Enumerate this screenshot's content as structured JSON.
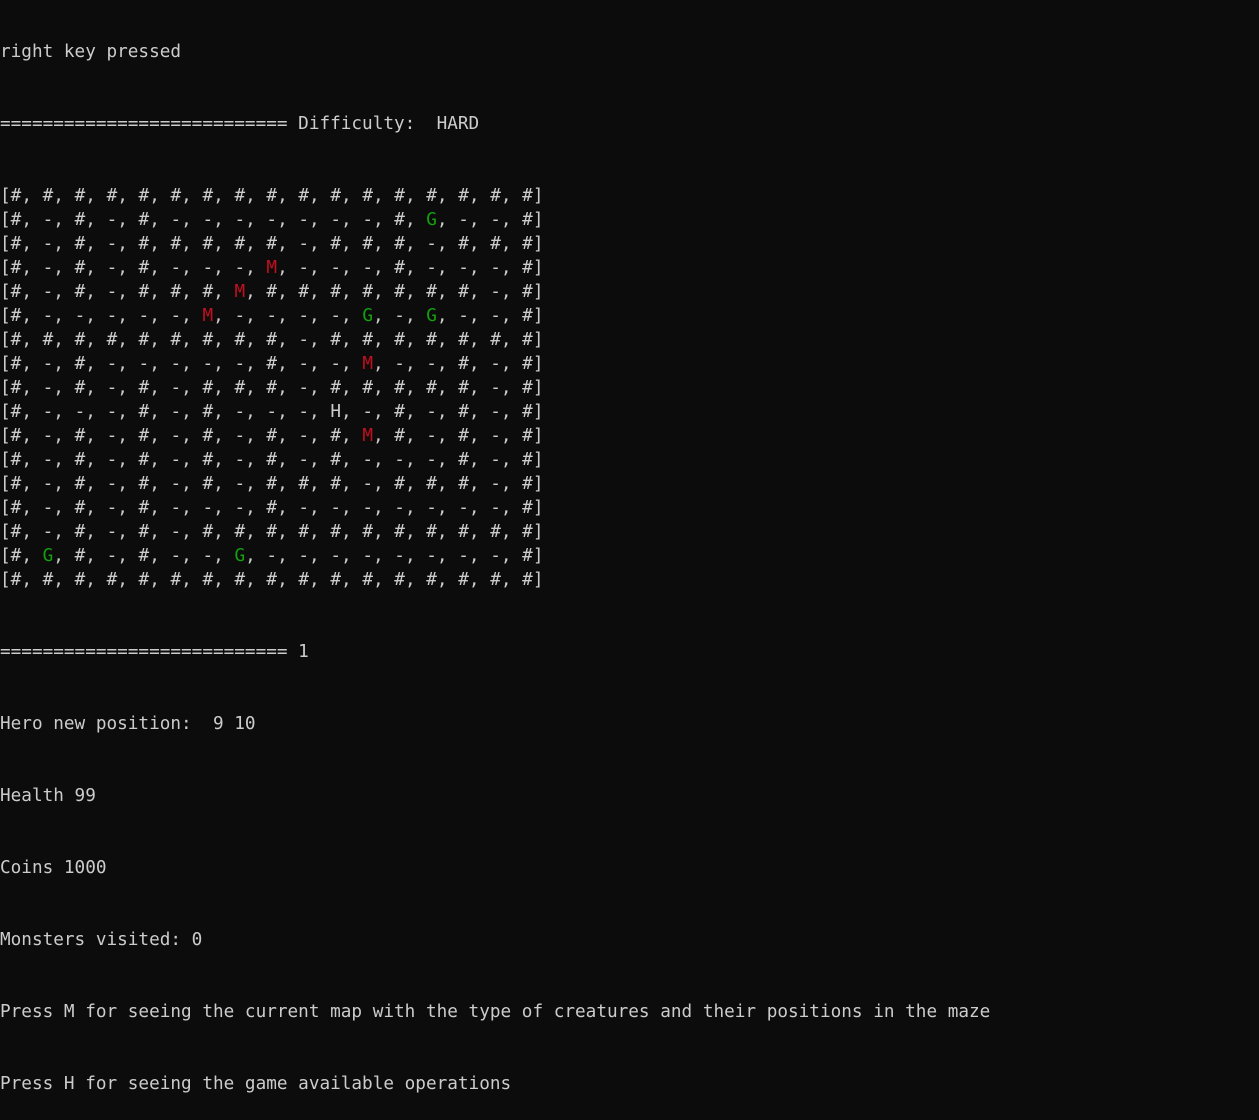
{
  "terminal": {
    "top_line": "right key pressed",
    "header": "=========================== Difficulty:  HARD",
    "maze": [
      [
        "#",
        "#",
        "#",
        "#",
        "#",
        "#",
        "#",
        "#",
        "#",
        "#",
        "#",
        "#",
        "#",
        "#",
        "#",
        "#",
        "#"
      ],
      [
        "#",
        "-",
        "#",
        "-",
        "#",
        "-",
        "-",
        "-",
        "-",
        "-",
        "-",
        "-",
        "#",
        "G",
        "-",
        "-",
        "#"
      ],
      [
        "#",
        "-",
        "#",
        "-",
        "#",
        "#",
        "#",
        "#",
        "#",
        "-",
        "#",
        "#",
        "#",
        "-",
        "#",
        "#",
        "#"
      ],
      [
        "#",
        "-",
        "#",
        "-",
        "#",
        "-",
        "-",
        "-",
        "M",
        "-",
        "-",
        "-",
        "#",
        "-",
        "-",
        "-",
        "#"
      ],
      [
        "#",
        "-",
        "#",
        "-",
        "#",
        "#",
        "#",
        "M",
        "#",
        "#",
        "#",
        "#",
        "#",
        "#",
        "#",
        "-",
        "#"
      ],
      [
        "#",
        "-",
        "-",
        "-",
        "-",
        "-",
        "M",
        "-",
        "-",
        "-",
        "-",
        "G",
        "-",
        "G",
        "-",
        "-",
        "#"
      ],
      [
        "#",
        "#",
        "#",
        "#",
        "#",
        "#",
        "#",
        "#",
        "#",
        "-",
        "#",
        "#",
        "#",
        "#",
        "#",
        "#",
        "#"
      ],
      [
        "#",
        "-",
        "#",
        "-",
        "-",
        "-",
        "-",
        "-",
        "#",
        "-",
        "-",
        "M",
        "-",
        "-",
        "#",
        "-",
        "#"
      ],
      [
        "#",
        "-",
        "#",
        "-",
        "#",
        "-",
        "#",
        "#",
        "#",
        "-",
        "#",
        "#",
        "#",
        "#",
        "#",
        "-",
        "#"
      ],
      [
        "#",
        "-",
        "-",
        "-",
        "#",
        "-",
        "#",
        "-",
        "-",
        "-",
        "H",
        "-",
        "#",
        "-",
        "#",
        "-",
        "#"
      ],
      [
        "#",
        "-",
        "#",
        "-",
        "#",
        "-",
        "#",
        "-",
        "#",
        "-",
        "#",
        "M",
        "#",
        "-",
        "#",
        "-",
        "#"
      ],
      [
        "#",
        "-",
        "#",
        "-",
        "#",
        "-",
        "#",
        "-",
        "#",
        "-",
        "#",
        "-",
        "-",
        "-",
        "#",
        "-",
        "#"
      ],
      [
        "#",
        "-",
        "#",
        "-",
        "#",
        "-",
        "#",
        "-",
        "#",
        "#",
        "#",
        "-",
        "#",
        "#",
        "#",
        "-",
        "#"
      ],
      [
        "#",
        "-",
        "#",
        "-",
        "#",
        "-",
        "-",
        "-",
        "#",
        "-",
        "-",
        "-",
        "-",
        "-",
        "-",
        "-",
        "#"
      ],
      [
        "#",
        "-",
        "#",
        "-",
        "#",
        "-",
        "#",
        "#",
        "#",
        "#",
        "#",
        "#",
        "#",
        "#",
        "#",
        "#",
        "#"
      ],
      [
        "#",
        "G",
        "#",
        "-",
        "#",
        "-",
        "-",
        "G",
        "-",
        "-",
        "-",
        "-",
        "-",
        "-",
        "-",
        "-",
        "#"
      ],
      [
        "#",
        "#",
        "#",
        "#",
        "#",
        "#",
        "#",
        "#",
        "#",
        "#",
        "#",
        "#",
        "#",
        "#",
        "#",
        "#",
        "#"
      ]
    ],
    "footer": "=========================== 1",
    "hero_position": "Hero new position:  9 10",
    "health": "Health 99",
    "coins": "Coins 1000",
    "monsters_visited": "Monsters visited: 0",
    "help_map": "Press M for seeing the current map with the type of creatures and their positions in the maze",
    "help_ops": "Press H for seeing the game available operations"
  },
  "colors": {
    "background": "#0c0c0c",
    "text": "#cccccc",
    "gold": "#13a10e",
    "monster": "#c50f1f"
  }
}
